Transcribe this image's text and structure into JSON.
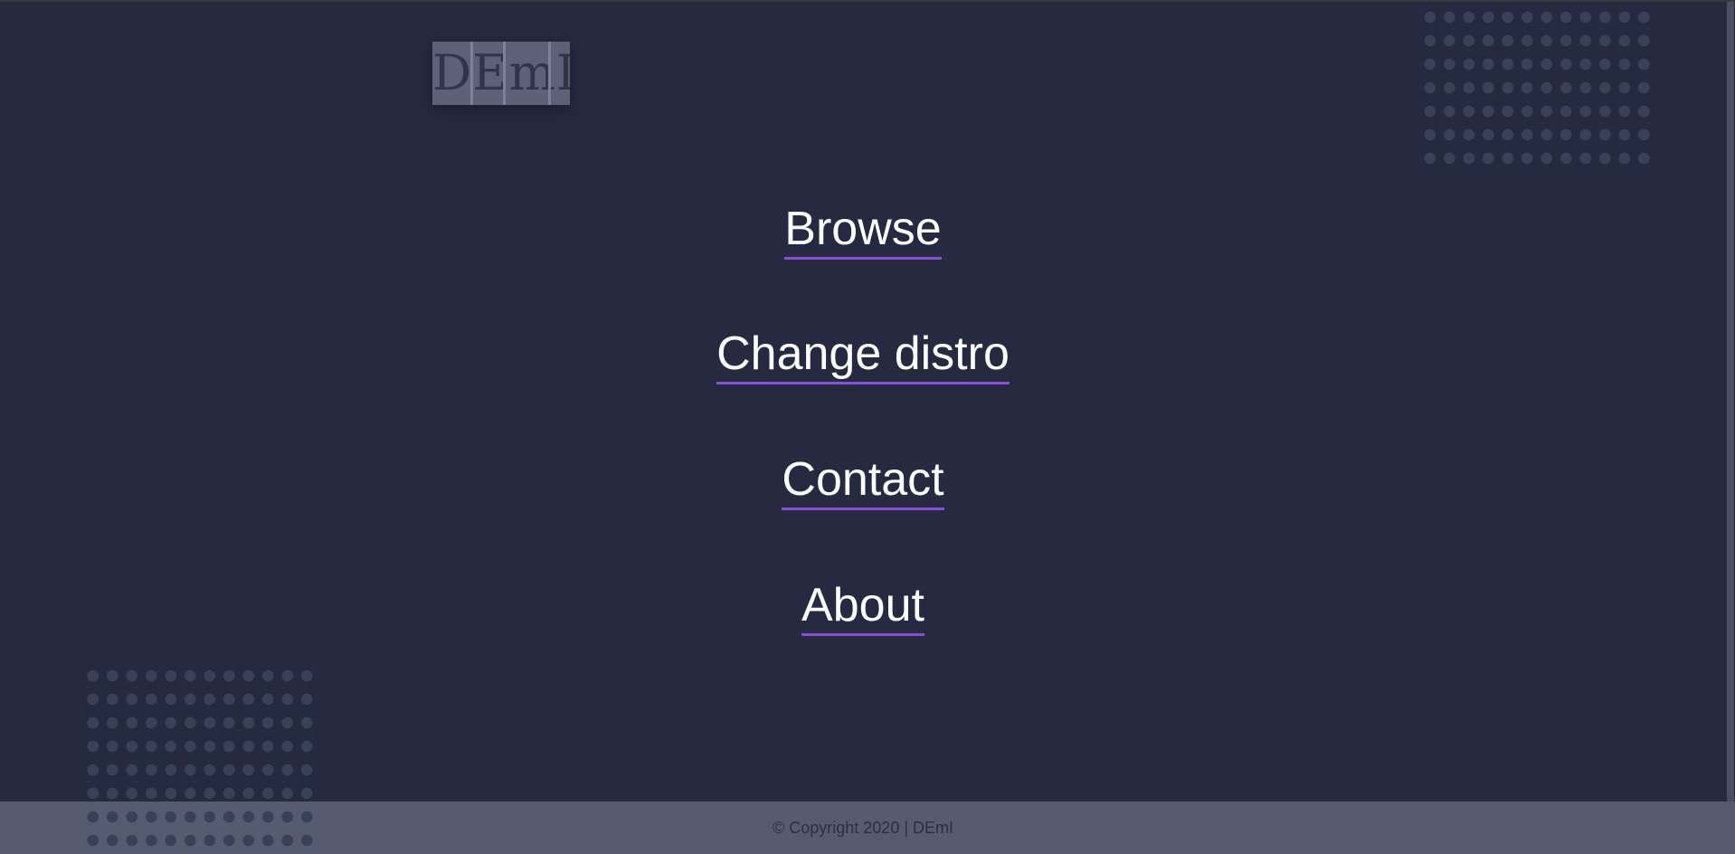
{
  "logo": {
    "text": "DEmI"
  },
  "nav": {
    "items": [
      {
        "label": "Browse"
      },
      {
        "label": "Change distro"
      },
      {
        "label": "Contact"
      },
      {
        "label": "About"
      }
    ]
  },
  "footer": {
    "copyright": "© Copyright 2020 | DEmI"
  },
  "colors": {
    "background": "#252a41",
    "accent_underline": "#8a4fd6",
    "footer_background": "#575b72",
    "dot_pattern": "#3b4059"
  }
}
